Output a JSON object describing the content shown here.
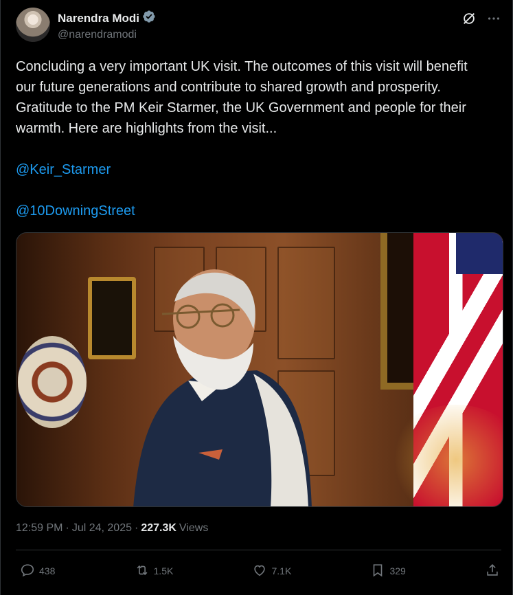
{
  "author": {
    "display_name": "Narendra Modi",
    "handle": "@narendramodi"
  },
  "post": {
    "text": "Concluding a very important UK visit. The outcomes of this visit will benefit our future generations and contribute to shared growth and prosperity. Gratitude to the PM Keir Starmer, the UK Government and people for their warmth. Here are highlights from the visit...",
    "mentions": [
      "@Keir_Starmer",
      "@10DowningStreet"
    ]
  },
  "meta": {
    "time": "12:59 PM",
    "separator": "·",
    "date": "Jul 24, 2025",
    "separator2": "·",
    "views_count": "227.3K",
    "views_label": "Views"
  },
  "actions": {
    "replies": "438",
    "reposts": "1.5K",
    "likes": "7.1K",
    "bookmarks": "329"
  },
  "icons": {
    "verified": "verified-badge-icon",
    "grok": "grok-icon",
    "more": "more-icon",
    "reply": "reply-icon",
    "repost": "repost-icon",
    "like": "like-icon",
    "bookmark": "bookmark-icon",
    "share": "share-icon"
  },
  "colors": {
    "background": "#000000",
    "text": "#e7e9ea",
    "secondary": "#71767b",
    "link": "#1d9bf0",
    "border": "#2f3336"
  }
}
